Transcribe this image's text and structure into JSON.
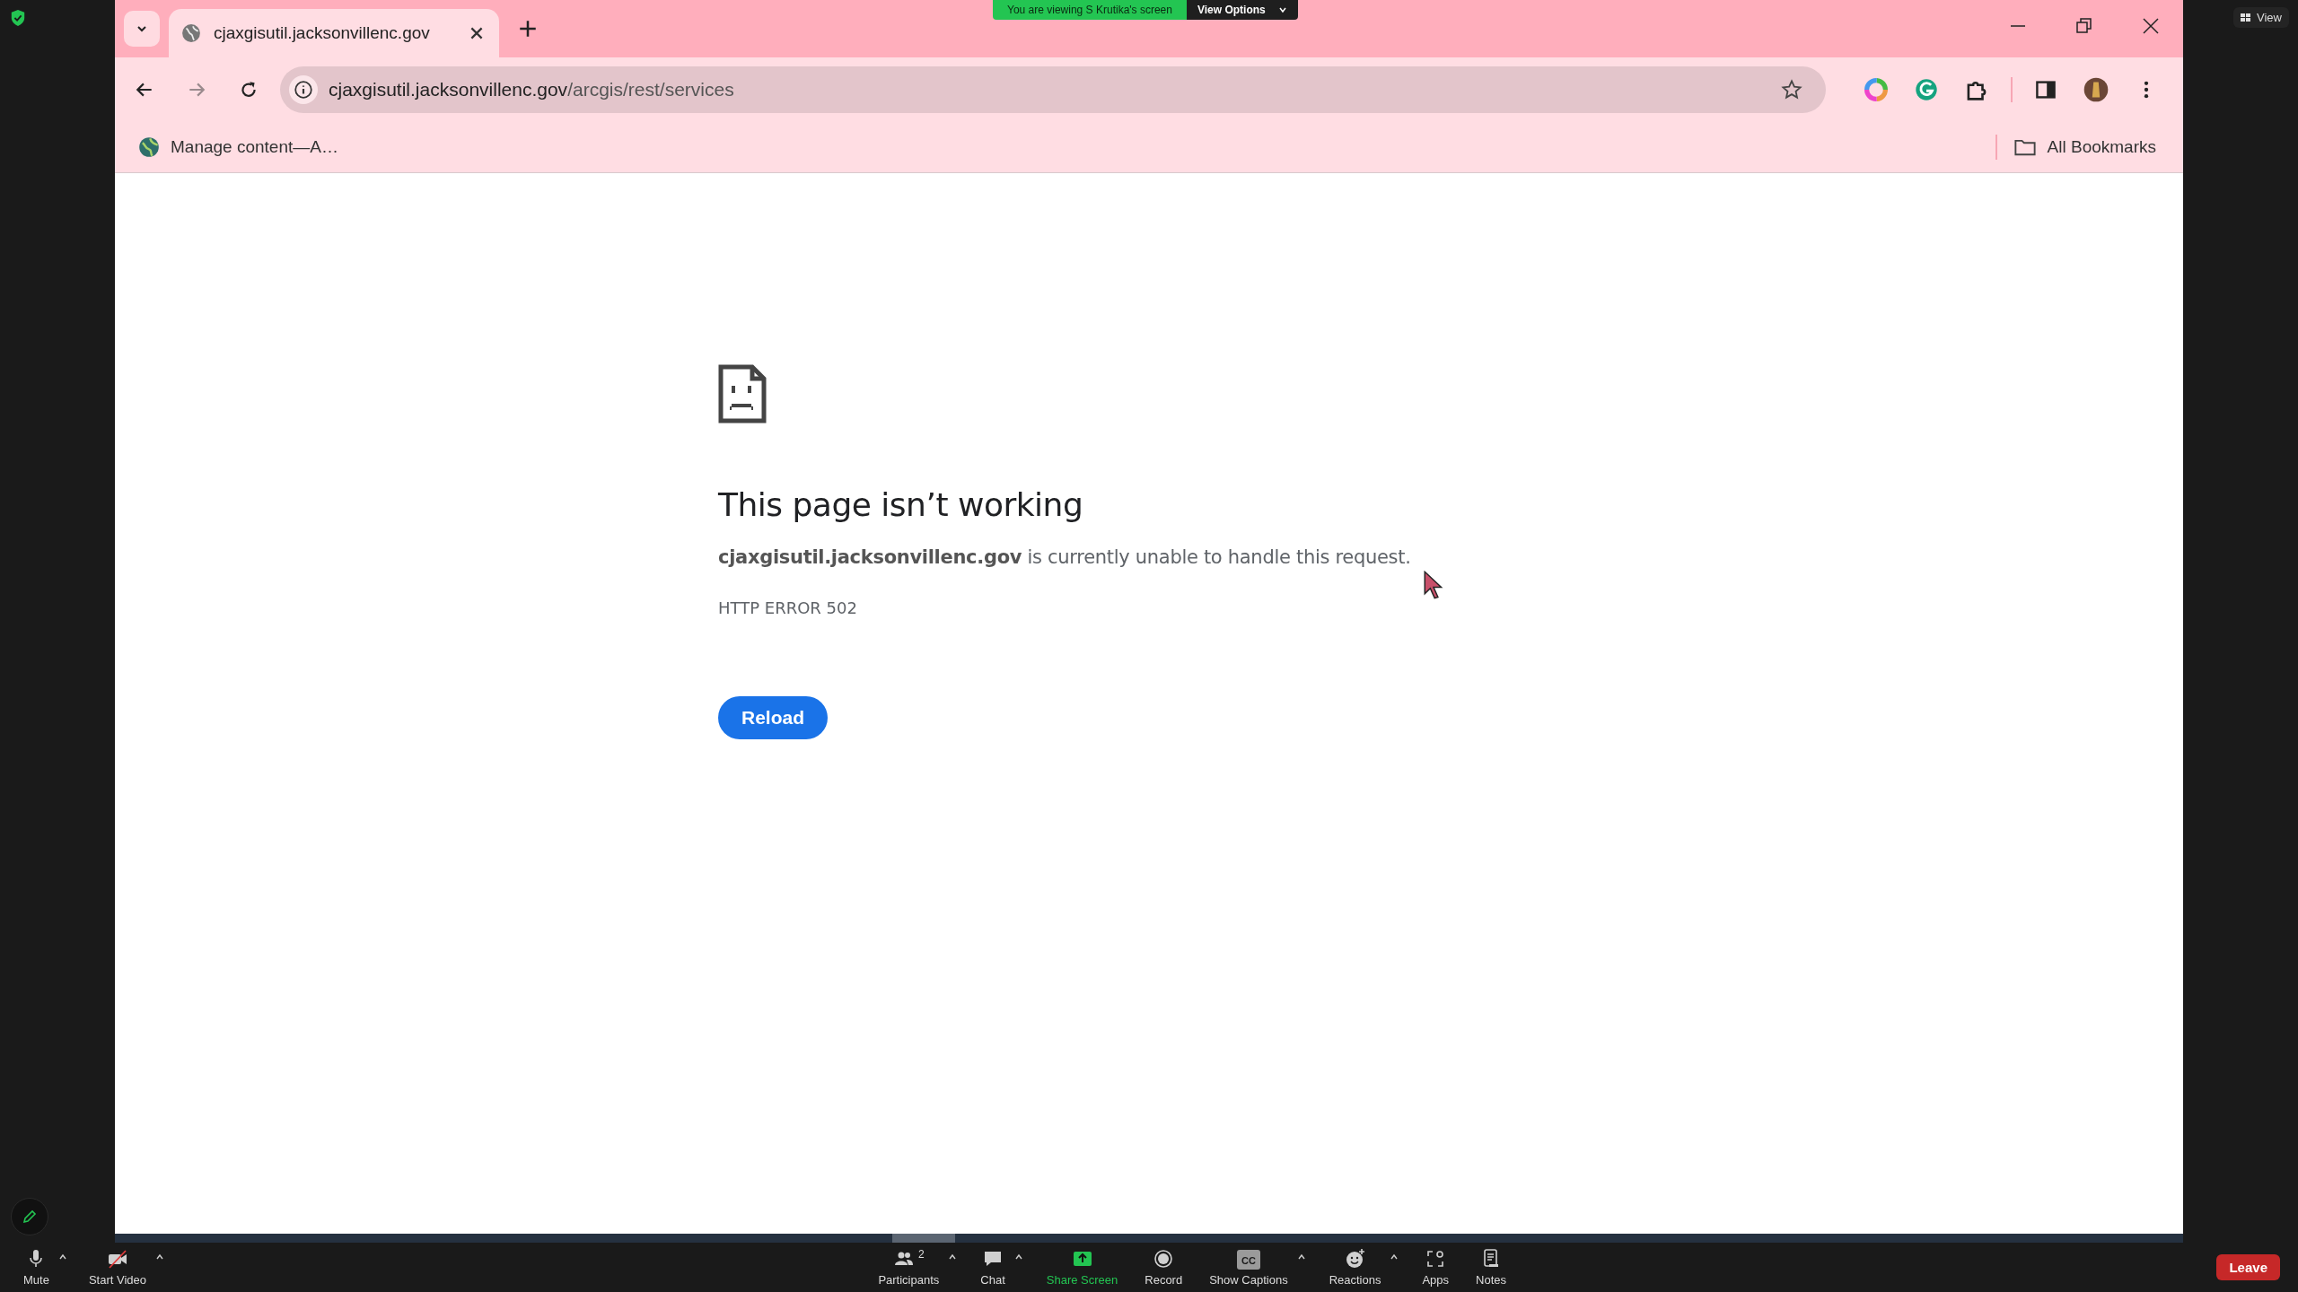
{
  "zoom": {
    "banner": "You are viewing S Krutika's screen",
    "view_options": "View Options",
    "view_button": "View",
    "toolbar_left": [
      {
        "kind": "mic",
        "label": "Mute",
        "caret": true,
        "highlighted": false
      },
      {
        "kind": "video-off",
        "label": "Start Video",
        "caret": true,
        "highlighted": false
      }
    ],
    "toolbar_center": [
      {
        "kind": "participants",
        "label": "Participants",
        "count": "2",
        "caret": true,
        "highlighted": false
      },
      {
        "kind": "chat",
        "label": "Chat",
        "caret": true,
        "highlighted": false
      },
      {
        "kind": "share",
        "label": "Share Screen",
        "caret": false,
        "highlighted": true
      },
      {
        "kind": "record",
        "label": "Record",
        "caret": false,
        "highlighted": false
      },
      {
        "kind": "captions",
        "label": "Show Captions",
        "badge": "CC",
        "caret": true,
        "highlighted": false
      },
      {
        "kind": "reactions",
        "label": "Reactions",
        "caret": true,
        "highlighted": false
      },
      {
        "kind": "apps",
        "label": "Apps",
        "caret": false,
        "highlighted": false
      },
      {
        "kind": "notes",
        "label": "Notes",
        "caret": false,
        "highlighted": false
      }
    ],
    "leave": "Leave"
  },
  "browser": {
    "tabs": [
      {
        "title": "cjaxgisutil.jacksonvillenc.gov",
        "selected": true
      }
    ],
    "nav": [
      {
        "kind": "back",
        "disabled": false
      },
      {
        "kind": "forward",
        "disabled": true
      },
      {
        "kind": "reload",
        "disabled": false
      }
    ],
    "address": {
      "host": "cjaxgisutil.jacksonvillenc.gov",
      "path": "/arcgis/rest/services"
    },
    "bookmarks": [
      {
        "label": "Manage content—A…"
      }
    ],
    "all_bookmarks": "All Bookmarks"
  },
  "page": {
    "title": "This page isn’t working",
    "message": "**cjaxgisutil.jacksonvillenc.gov** is currently unable to handle this request.",
    "error_code": "HTTP ERROR 502",
    "button": "Reload"
  }
}
